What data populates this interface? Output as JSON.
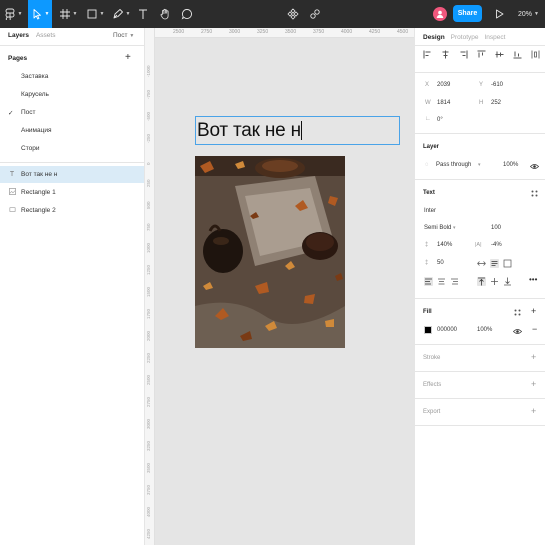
{
  "toolbar": {
    "share_label": "Share",
    "zoom": "20%"
  },
  "left_panel": {
    "tabs": [
      "Layers",
      "Assets"
    ],
    "page_select": "Пост",
    "pages_title": "Pages",
    "pages": [
      {
        "label": "Заставка",
        "active": false
      },
      {
        "label": "Карусель",
        "active": false
      },
      {
        "label": "Пост",
        "active": true
      },
      {
        "label": "Анимация",
        "active": false
      },
      {
        "label": "Стори",
        "active": false
      }
    ],
    "layers": [
      {
        "label": "Вот так не н",
        "icon": "text-icon",
        "selected": true
      },
      {
        "label": "Rectangle 1",
        "icon": "image-rect-icon",
        "selected": false
      },
      {
        "label": "Rectangle 2",
        "icon": "rect-icon",
        "selected": false
      }
    ]
  },
  "canvas": {
    "ruler_top": [
      "2500",
      "2750",
      "3000",
      "3250",
      "3500",
      "3750",
      "4000",
      "4250",
      "4500"
    ],
    "ruler_left": [
      "-1000",
      "-750",
      "-500",
      "-250",
      "0",
      "250",
      "500",
      "750",
      "1000",
      "1250",
      "1500",
      "1750",
      "2000",
      "2250",
      "2500",
      "2750",
      "3000",
      "3250",
      "3500",
      "3750",
      "4000",
      "4250",
      "4500"
    ],
    "text_content": "Вот так не н"
  },
  "right_panel": {
    "tabs": [
      "Design",
      "Prototype",
      "Inspect"
    ],
    "x_label": "X",
    "x_value": "2039",
    "y_label": "Y",
    "y_value": "-610",
    "w_label": "W",
    "w_value": "1814",
    "h_label": "H",
    "h_value": "252",
    "rotation": "0°",
    "layer_title": "Layer",
    "blend_mode": "Pass through",
    "layer_opacity": "100%",
    "text_title": "Text",
    "font_family": "Inter",
    "font_weight": "Semi Bold",
    "font_size": "100",
    "line_height": "140%",
    "letter_spacing": "-4%",
    "paragraph_spacing": "50",
    "fill_title": "Fill",
    "fill_hex": "000000",
    "fill_opacity": "100%",
    "fill_color": "#000000",
    "stroke_title": "Stroke",
    "effects_title": "Effects",
    "export_title": "Export"
  },
  "colors": {
    "accent": "#0d99ff",
    "toolbar_bg": "#2c2c2c",
    "selection": "#daebf7",
    "avatar": "#f0577d"
  }
}
